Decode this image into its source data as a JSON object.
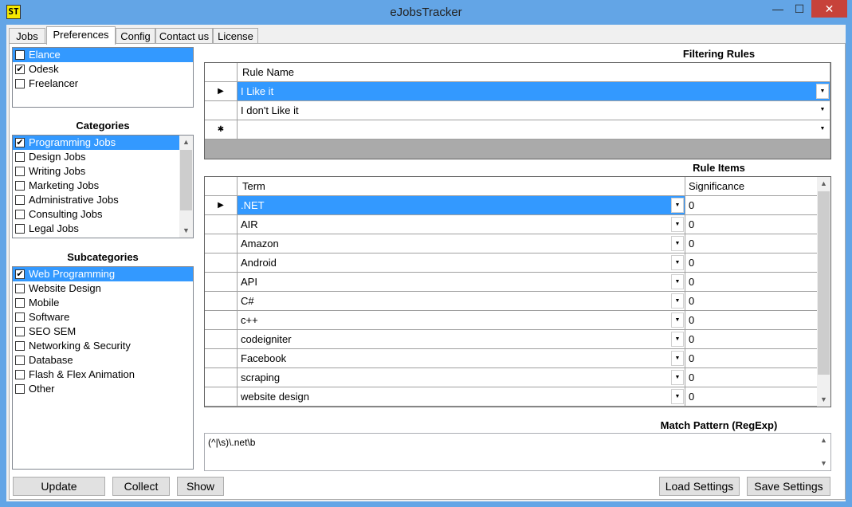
{
  "window": {
    "title": "eJobsTracker",
    "icon_text": "ST",
    "min_glyph": "—",
    "max_glyph": "☐",
    "close_glyph": "✕"
  },
  "tabs": [
    {
      "label": "Jobs"
    },
    {
      "label": "Preferences"
    },
    {
      "label": "Config"
    },
    {
      "label": "Contact us"
    },
    {
      "label": "License"
    }
  ],
  "sources": [
    {
      "label": "Elance",
      "checked": false,
      "selected": true
    },
    {
      "label": "Odesk",
      "checked": true,
      "selected": false
    },
    {
      "label": "Freelancer",
      "checked": false,
      "selected": false
    }
  ],
  "categories": {
    "title": "Categories",
    "items": [
      {
        "label": "Programming Jobs",
        "checked": true,
        "selected": true
      },
      {
        "label": "Design Jobs",
        "checked": false
      },
      {
        "label": "Writing Jobs",
        "checked": false
      },
      {
        "label": "Marketing Jobs",
        "checked": false
      },
      {
        "label": "Administrative Jobs",
        "checked": false
      },
      {
        "label": "Consulting Jobs",
        "checked": false
      },
      {
        "label": "Legal Jobs",
        "checked": false
      }
    ]
  },
  "subcategories": {
    "title": "Subcategories",
    "items": [
      {
        "label": "Web Programming",
        "checked": true,
        "selected": true
      },
      {
        "label": "Website Design",
        "checked": false
      },
      {
        "label": "Mobile",
        "checked": false
      },
      {
        "label": "Software",
        "checked": false
      },
      {
        "label": "SEO SEM",
        "checked": false
      },
      {
        "label": "Networking & Security",
        "checked": false
      },
      {
        "label": "Database",
        "checked": false
      },
      {
        "label": "Flash & Flex Animation",
        "checked": false
      },
      {
        "label": "Other",
        "checked": false
      }
    ]
  },
  "filtering_rules": {
    "title": "Filtering Rules",
    "column": "Rule Name",
    "rows": [
      "I Like it",
      "I don't Like it"
    ],
    "new_row_glyph": "✱",
    "current_glyph": "▶"
  },
  "rule_items": {
    "title": "Rule Items",
    "columns": [
      "Term",
      "Significance"
    ],
    "rows": [
      {
        "term": ".NET",
        "significance": "0"
      },
      {
        "term": "AIR",
        "significance": "0"
      },
      {
        "term": "Amazon",
        "significance": "0"
      },
      {
        "term": "Android",
        "significance": "0"
      },
      {
        "term": "API",
        "significance": "0"
      },
      {
        "term": "C#",
        "significance": "0"
      },
      {
        "term": "c++",
        "significance": "0"
      },
      {
        "term": "codeigniter",
        "significance": "0"
      },
      {
        "term": "Facebook",
        "significance": "0"
      },
      {
        "term": "scraping",
        "significance": "0"
      },
      {
        "term": "website design",
        "significance": "0"
      }
    ]
  },
  "match_pattern": {
    "title": "Match Pattern (RegExp)",
    "value": "(^|\\s)\\.net\\b"
  },
  "buttons": {
    "update": "Update",
    "collect": "Collect",
    "show": "Show",
    "load_settings": "Load Settings",
    "save_settings": "Save Settings"
  },
  "glyphs": {
    "check": "✔",
    "arrow_up": "▲",
    "arrow_down": "▼",
    "dropdown": "▼"
  },
  "colors": {
    "selection": "#3399ff",
    "titlebar": "#63a5e6",
    "close": "#c7423a"
  }
}
